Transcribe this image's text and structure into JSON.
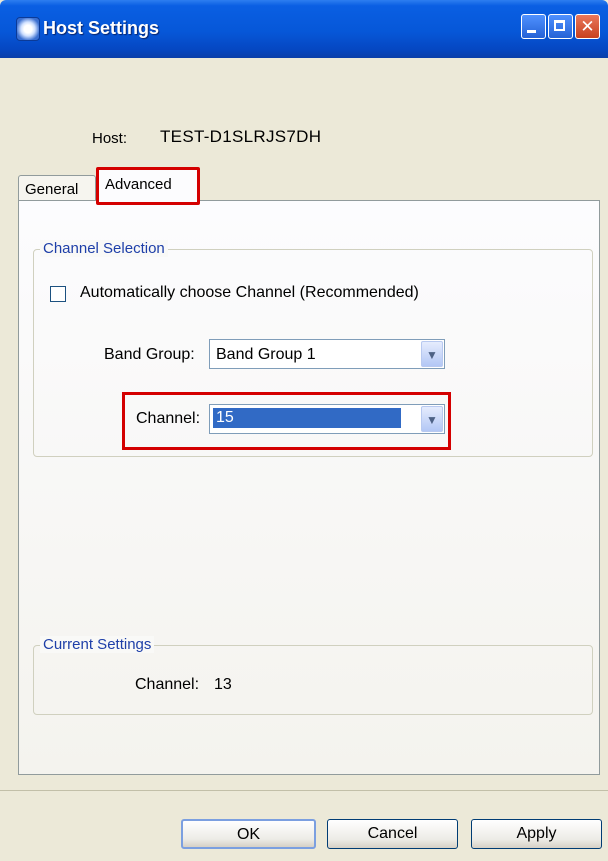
{
  "window": {
    "title": "Host Settings",
    "close_glyph": "✕"
  },
  "host": {
    "label": "Host:",
    "value": "TEST-D1SLRJS7DH"
  },
  "tabs": [
    {
      "label": "General",
      "selected": false
    },
    {
      "label": "Advanced",
      "selected": true
    }
  ],
  "channel_selection": {
    "legend": "Channel Selection",
    "auto_choose": {
      "label": "Automatically choose Channel (Recommended)",
      "checked": false
    },
    "band_group": {
      "label": "Band Group:",
      "value": "Band Group 1"
    },
    "channel": {
      "label": "Channel:",
      "value": "15"
    },
    "dropdown_arrow": "▼"
  },
  "current_settings": {
    "legend": "Current Settings",
    "channel_label": "Channel:",
    "channel_value": "13"
  },
  "buttons": {
    "ok": "OK",
    "cancel": "Cancel",
    "apply": "Apply"
  },
  "colors": {
    "highlight_red": "#d40000",
    "title_blue": "#0657d8",
    "selection_blue": "#316ac5",
    "legend_blue": "#1e3fa8"
  }
}
